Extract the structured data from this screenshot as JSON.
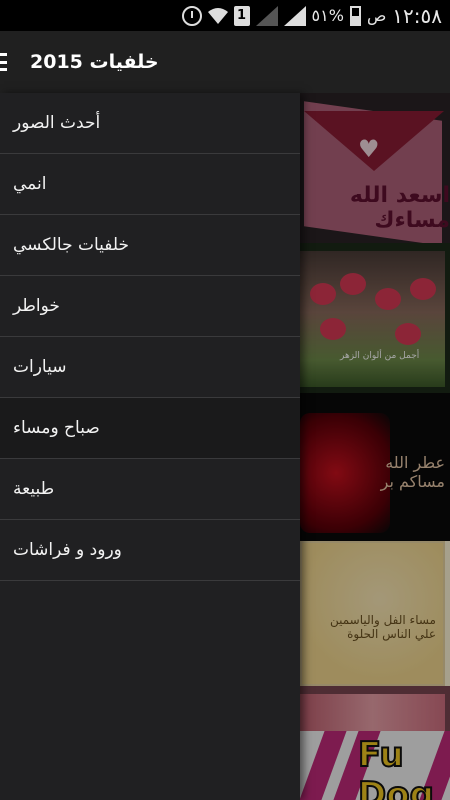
{
  "status_bar": {
    "time": "١٢:٥٨",
    "am_pm": "ص",
    "battery_percent": "٥١%",
    "sim_slot": "1"
  },
  "app_bar": {
    "title": "خلفيات 2015"
  },
  "drawer": {
    "items": [
      {
        "label": "أحدث الصور"
      },
      {
        "label": "انمي"
      },
      {
        "label": "خلفيات جالكسي"
      },
      {
        "label": "خواطر"
      },
      {
        "label": "سيارات"
      },
      {
        "label": "صباح ومساء"
      },
      {
        "label": "طبيعة"
      },
      {
        "label": "ورود و فراشات"
      }
    ]
  },
  "content": {
    "thumbnails": [
      {
        "text": "اسعد الله مساءك"
      },
      {
        "text": "أجمل من ألوان الزهر"
      },
      {
        "text": "عطر الله مساكم بر"
      },
      {
        "text": "مساء الفل والياسمين علي الناس الحلوة"
      },
      {
        "text": ""
      },
      {
        "text": "Fu Dog"
      }
    ]
  }
}
